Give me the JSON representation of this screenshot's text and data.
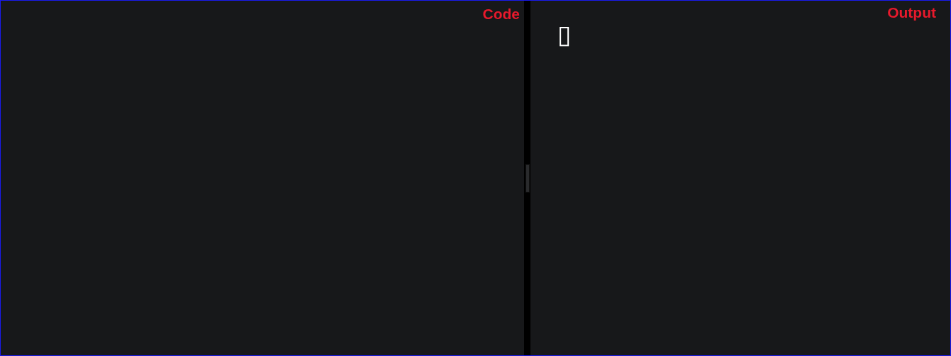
{
  "code_pane": {
    "label": "Code"
  },
  "output_pane": {
    "label": "Output",
    "output": "▯"
  }
}
